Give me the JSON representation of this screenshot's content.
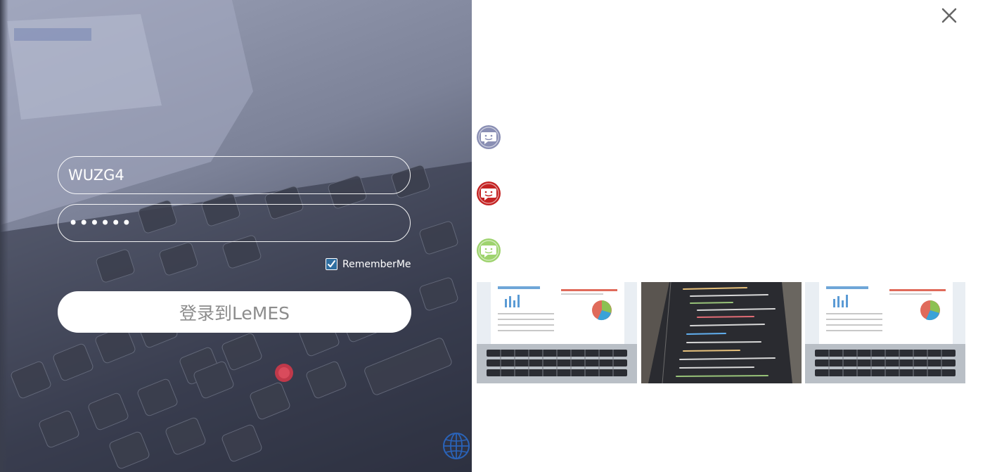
{
  "login": {
    "username_value": "WUZG4",
    "password_value": "••••••",
    "remember_label": "RememberMe",
    "remember_checked": true,
    "submit_label": "登录到LeMES"
  },
  "icons": {
    "language": "globe-icon",
    "close": "close-icon",
    "chats": [
      "chat-bubble-icon",
      "chat-bubble-icon",
      "chat-bubble-icon"
    ]
  },
  "colors": {
    "chat_1": "#8a8fb4",
    "chat_2": "#c42323",
    "chat_3": "#9ed36e",
    "checkbox": "#2f6ea0",
    "button_text": "#8c8c8c",
    "globe": "#2a63b8"
  },
  "thumbnails": [
    {
      "kind": "dashboard-laptop"
    },
    {
      "kind": "code-screen"
    },
    {
      "kind": "dashboard-laptop"
    }
  ]
}
